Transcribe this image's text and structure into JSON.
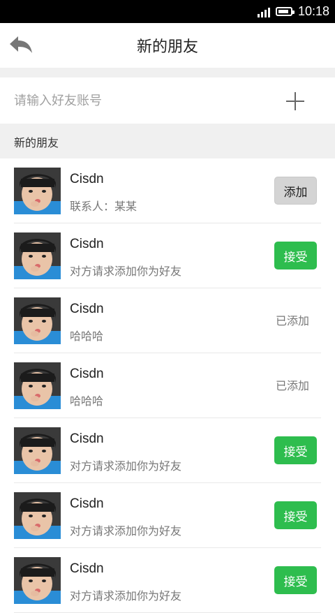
{
  "status_bar": {
    "time": "10:18"
  },
  "header": {
    "title": "新的朋友"
  },
  "search": {
    "placeholder": "请输入好友账号"
  },
  "section": {
    "label": "新的朋友"
  },
  "rows": [
    {
      "name": "Cisdn",
      "message": "联系人：某某",
      "action": "添加",
      "action_type": "add"
    },
    {
      "name": "Cisdn",
      "message": "对方请求添加你为好友",
      "action": "接受",
      "action_type": "accept"
    },
    {
      "name": "Cisdn",
      "message": "哈哈哈",
      "action": "已添加",
      "action_type": "added"
    },
    {
      "name": "Cisdn",
      "message": "哈哈哈",
      "action": "已添加",
      "action_type": "added"
    },
    {
      "name": "Cisdn",
      "message": "对方请求添加你为好友",
      "action": "接受",
      "action_type": "accept"
    },
    {
      "name": "Cisdn",
      "message": "对方请求添加你为好友",
      "action": "接受",
      "action_type": "accept"
    },
    {
      "name": "Cisdn",
      "message": "对方请求添加你为好友",
      "action": "接受",
      "action_type": "accept"
    }
  ],
  "colors": {
    "accept": "#2ebd4e",
    "add": "#d4d4d4",
    "section_bg": "#f0f0f0"
  }
}
